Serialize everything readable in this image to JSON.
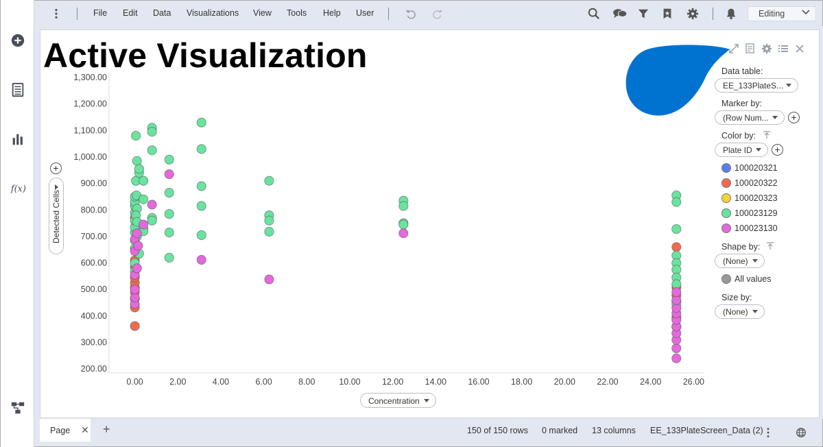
{
  "menu": {
    "items": [
      "File",
      "Edit",
      "Data",
      "Visualizations",
      "View",
      "Tools",
      "Help",
      "User"
    ],
    "mode": "Editing"
  },
  "icons": {
    "rail": [
      "add-icon",
      "data-table-icon",
      "bar-chart-icon",
      "function-icon",
      "flow-icon"
    ],
    "toolbar": [
      "more-icon",
      "undo-icon",
      "redo-icon",
      "search-icon",
      "comment-icon",
      "filter-icon",
      "bookmark-icon",
      "settings-icon",
      "notification-icon"
    ],
    "panel": [
      "maximize-icon",
      "properties-icon",
      "settings-icon",
      "legend-list-icon",
      "close-icon"
    ]
  },
  "visualization": {
    "title": "Active Visualization",
    "title_color": "#000000",
    "blob_color": "#0073d1"
  },
  "legend": {
    "data_table_label": "Data table:",
    "data_table_value": "EE_133PlateS...",
    "marker_by_label": "Marker by:",
    "marker_by_value": "(Row Num...",
    "color_by_label": "Color by:",
    "color_by_value": "Plate ID",
    "color_items": [
      {
        "label": "100020321",
        "color": "#5b7de8"
      },
      {
        "label": "100020322",
        "color": "#f06a50"
      },
      {
        "label": "100020323",
        "color": "#f5d33b"
      },
      {
        "label": "100023129",
        "color": "#6be3a0"
      },
      {
        "label": "100023130",
        "color": "#e569dc"
      }
    ],
    "shape_by_label": "Shape by:",
    "shape_by_value": "(None)",
    "shape_all_values": "All values",
    "shape_color": "#999999",
    "size_by_label": "Size by:",
    "size_by_value": "(None)"
  },
  "chart_data": {
    "type": "scatter",
    "xlabel": "Concentration",
    "ylabel": "Detected Cells",
    "xlim": [
      -1.2,
      26.5
    ],
    "ylim": [
      185,
      1318
    ],
    "x_ticks": [
      "0.00",
      "2.00",
      "4.00",
      "6.00",
      "8.00",
      "10.00",
      "12.00",
      "14.00",
      "16.00",
      "18.00",
      "20.00",
      "22.00",
      "24.00",
      "26.00"
    ],
    "y_ticks": [
      "200.00",
      "300.00",
      "400.00",
      "500.00",
      "600.00",
      "700.00",
      "800.00",
      "900.00",
      "1,000.00",
      "1,100.00",
      "1,200.00",
      "1,300.00"
    ],
    "series": [
      {
        "name": "100020322",
        "color": "#f06a50",
        "points": [
          [
            0,
            362
          ],
          [
            0,
            432
          ],
          [
            0,
            465
          ],
          [
            0,
            490
          ],
          [
            0,
            508
          ],
          [
            0,
            525
          ],
          [
            0,
            545
          ],
          [
            0,
            585
          ],
          [
            0,
            610
          ],
          [
            0,
            770
          ],
          [
            25.2,
            360
          ],
          [
            25.2,
            395
          ],
          [
            25.2,
            455
          ],
          [
            25.2,
            478
          ],
          [
            25.2,
            508
          ],
          [
            25.2,
            660
          ]
        ]
      },
      {
        "name": "100023129",
        "color": "#6be3a0",
        "points": [
          [
            0,
            570
          ],
          [
            0,
            600
          ],
          [
            0,
            655
          ],
          [
            0,
            685
          ],
          [
            0,
            715
          ],
          [
            0,
            735
          ],
          [
            0,
            760
          ],
          [
            0,
            790
          ],
          [
            0,
            815
          ],
          [
            0,
            830
          ],
          [
            0,
            850
          ],
          [
            0.05,
            1080
          ],
          [
            0.1,
            985
          ],
          [
            0.05,
            910
          ],
          [
            0.08,
            855
          ],
          [
            0.1,
            805
          ],
          [
            0.05,
            780
          ],
          [
            0.1,
            755
          ],
          [
            0.1,
            700
          ],
          [
            0.2,
            940
          ],
          [
            0.2,
            955
          ],
          [
            0.2,
            635
          ],
          [
            0.4,
            910
          ],
          [
            0.4,
            840
          ],
          [
            0.4,
            730
          ],
          [
            0.4,
            720
          ],
          [
            0.8,
            1110
          ],
          [
            0.8,
            1095
          ],
          [
            0.8,
            1025
          ],
          [
            0.8,
            770
          ],
          [
            0.8,
            760
          ],
          [
            1.6,
            990
          ],
          [
            1.6,
            865
          ],
          [
            1.6,
            785
          ],
          [
            1.6,
            715
          ],
          [
            1.6,
            620
          ],
          [
            3.1,
            1130
          ],
          [
            3.1,
            1030
          ],
          [
            3.1,
            890
          ],
          [
            3.1,
            815
          ],
          [
            3.1,
            705
          ],
          [
            6.25,
            910
          ],
          [
            6.25,
            780
          ],
          [
            6.25,
            760
          ],
          [
            6.25,
            718
          ],
          [
            12.5,
            835
          ],
          [
            12.5,
            815
          ],
          [
            12.5,
            750
          ],
          [
            12.5,
            745
          ],
          [
            25.2,
            855
          ],
          [
            25.2,
            830
          ],
          [
            25.2,
            728
          ],
          [
            25.2,
            628
          ],
          [
            25.2,
            600
          ],
          [
            25.2,
            575
          ],
          [
            25.2,
            545
          ],
          [
            25.2,
            520
          ],
          [
            25.2,
            445
          ]
        ]
      },
      {
        "name": "100023130",
        "color": "#e569dc",
        "points": [
          [
            0,
            445
          ],
          [
            0,
            470
          ],
          [
            0,
            500
          ],
          [
            0,
            555
          ],
          [
            0,
            645
          ],
          [
            0,
            690
          ],
          [
            0.1,
            580
          ],
          [
            0.1,
            712
          ],
          [
            0.15,
            665
          ],
          [
            0.4,
            745
          ],
          [
            0.8,
            820
          ],
          [
            1.6,
            935
          ],
          [
            3.1,
            612
          ],
          [
            6.25,
            538
          ],
          [
            12.5,
            712
          ],
          [
            25.2,
            240
          ],
          [
            25.2,
            278
          ],
          [
            25.2,
            310
          ],
          [
            25.2,
            335
          ],
          [
            25.2,
            360
          ],
          [
            25.2,
            385
          ],
          [
            25.2,
            410
          ],
          [
            25.2,
            430
          ],
          [
            25.2,
            460
          ],
          [
            25.2,
            490
          ]
        ]
      }
    ]
  },
  "bottom": {
    "page_tab": "Page",
    "rows": "150 of 150 rows",
    "marked": "0 marked",
    "columns": "13 columns",
    "table": "EE_133PlateScreen_Data (2)"
  }
}
